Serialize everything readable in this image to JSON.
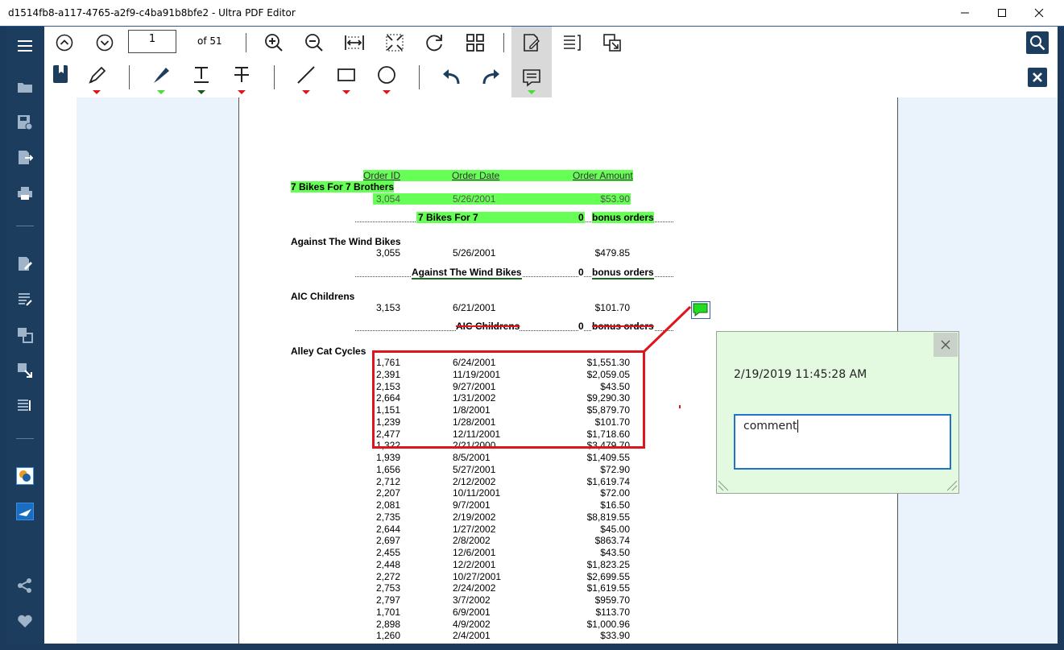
{
  "window": {
    "title": "d1514fb8-a117-4765-a2f9-c4ba91b8bfe2 - Ultra PDF Editor",
    "minimize_icon": "minimize-icon",
    "maximize_icon": "maximize-icon",
    "close_icon": "close-icon"
  },
  "toolbar": {
    "page_number": "1",
    "page_total": "of 51"
  },
  "colors": {
    "accent": "#1c3d5e",
    "highlight": "#66ff55",
    "annotation_box": "#e0141c",
    "popup_bg": "#e3fae0"
  },
  "document": {
    "header": {
      "order_id": "Order ID",
      "order_date": "Order Date",
      "order_amount": "Order Amount"
    },
    "groups": [
      {
        "name": "7 Bikes For 7 Brothers",
        "rows": [
          [
            "3,054",
            "5/26/2001",
            "$53.90"
          ]
        ],
        "summary_name": "7 Bikes For 7",
        "summary_count": "0",
        "summary_label": "bonus orders"
      },
      {
        "name": "Against The Wind Bikes",
        "rows": [
          [
            "3,055",
            "5/26/2001",
            "$479.85"
          ]
        ],
        "summary_name": "Against The Wind Bikes",
        "summary_count": "0",
        "summary_label": "bonus orders"
      },
      {
        "name": "AIC Childrens",
        "rows": [
          [
            "3,153",
            "6/21/2001",
            "$101.70"
          ]
        ],
        "summary_name": "AIC Childrens",
        "summary_count": "0",
        "summary_label": "bonus orders"
      },
      {
        "name": "Alley Cat Cycles",
        "rows": [
          [
            "1,761",
            "6/24/2001",
            "$1,551.30"
          ],
          [
            "2,391",
            "11/19/2001",
            "$2,059.05"
          ],
          [
            "2,153",
            "9/27/2001",
            "$43.50"
          ],
          [
            "2,664",
            "1/31/2002",
            "$9,290.30"
          ],
          [
            "1,151",
            "1/8/2001",
            "$5,879.70"
          ],
          [
            "1,239",
            "1/28/2001",
            "$101.70"
          ],
          [
            "2,477",
            "12/11/2001",
            "$1,718.60"
          ],
          [
            "1,322",
            "2/21/2000",
            "$3,479.70"
          ],
          [
            "1,939",
            "8/5/2001",
            "$1,409.55"
          ],
          [
            "1,656",
            "5/27/2001",
            "$72.90"
          ],
          [
            "2,712",
            "2/12/2002",
            "$1,619.74"
          ],
          [
            "2,207",
            "10/11/2001",
            "$72.00"
          ],
          [
            "2,081",
            "9/7/2001",
            "$16.50"
          ],
          [
            "2,735",
            "2/19/2002",
            "$8,819.55"
          ],
          [
            "2,644",
            "1/27/2002",
            "$45.00"
          ],
          [
            "2,697",
            "2/8/2002",
            "$863.74"
          ],
          [
            "2,455",
            "12/6/2001",
            "$43.50"
          ],
          [
            "2,448",
            "12/2/2001",
            "$1,823.25"
          ],
          [
            "2,272",
            "10/27/2001",
            "$2,699.55"
          ],
          [
            "2,753",
            "2/24/2002",
            "$1,619.55"
          ],
          [
            "2,797",
            "3/7/2002",
            "$959.70"
          ],
          [
            "1,701",
            "6/9/2001",
            "$113.70"
          ],
          [
            "2,898",
            "4/9/2002",
            "$1,000.96"
          ],
          [
            "1,260",
            "2/4/2001",
            "$33.90"
          ]
        ]
      }
    ]
  },
  "comment_popup": {
    "timestamp": "2/19/2019 11:45:28 AM",
    "text": "comment"
  }
}
